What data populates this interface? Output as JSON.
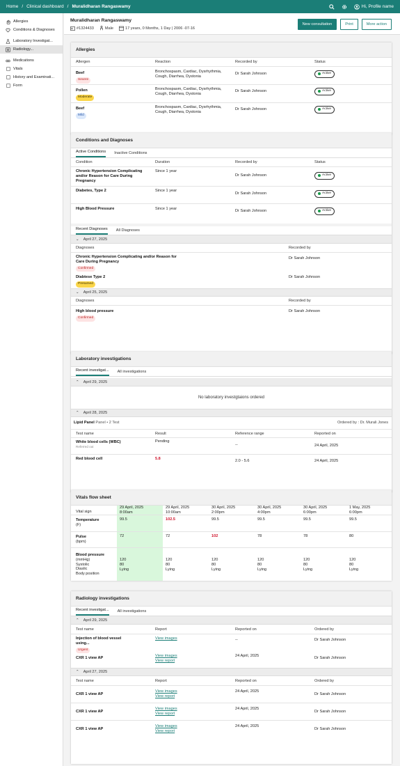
{
  "topbar": {
    "home": "Home",
    "sep": "/",
    "clinical": "Clinical dashboard",
    "patient": "Muralidharan Rangaswamy",
    "profile": "Hi, Profile name"
  },
  "sidebar": {
    "items": [
      {
        "label": "Allergies",
        "icon": "allergy-icon"
      },
      {
        "label": "Conditions & Diagnoses",
        "icon": "heart-icon"
      },
      {
        "label": "Laboratory Investigat...",
        "icon": "flask-icon"
      },
      {
        "label": "Radiology...",
        "icon": "xray-icon"
      },
      {
        "label": "Medications",
        "icon": "pill-icon"
      },
      {
        "label": "Vitals",
        "icon": "checkbox-icon"
      },
      {
        "label": "History and Examinati...",
        "icon": "checkbox-icon"
      },
      {
        "label": "Form",
        "icon": "checkbox-icon"
      }
    ]
  },
  "patient": {
    "name": "Muralidharan Rangaswamy",
    "id": "#1324433",
    "gender": "Male",
    "age": "17 years, 0 Months, 1 Day | 2006 -07-16"
  },
  "actions": {
    "new": "New consultation",
    "print": "Print",
    "more": "More action"
  },
  "allergies": {
    "title": "Allergies",
    "headers": [
      "Allergen",
      "Reaction",
      "Recorded by",
      "Status"
    ],
    "rows": [
      {
        "allergen": "Beef",
        "severity": "Severe",
        "reaction": "Bronchospasm, Cardiac, Dysrhythmia, Cough, Diarrhea, Dystonia",
        "by": "Dr Sarah Johnson",
        "status": "Active"
      },
      {
        "allergen": "Pollen",
        "severity": "Moderate",
        "reaction": "Bronchospasm, Cardiac, Dysrhythmia, Cough, Diarrhea, Dystonia",
        "by": "Dr Sarah Johnson",
        "status": "Active"
      },
      {
        "allergen": "Beef",
        "severity": "Mild",
        "reaction": "Bronchospasm, Cardiac, Dysrhythmia, Cough, Diarrhea, Dystonia",
        "by": "Dr Sarah Johnson",
        "status": "Active"
      }
    ]
  },
  "conditions": {
    "title": "Conditions and Diagnoses",
    "tab1": "Active Conditions",
    "tab2": "Inactive Conditions",
    "headers": [
      "Condition",
      "Duration",
      "Recorded by",
      "Status"
    ],
    "rows": [
      {
        "name": "Chronic Hypertension Complicating and/or Reason for Care During Pregnancy",
        "duration": "Since 1 year",
        "by": "Dr Sarah Johnson",
        "status": "Active"
      },
      {
        "name": "Diabetes, Type 2",
        "duration": "Since 1 year",
        "by": "Dr Sarah Johnson",
        "status": "Active"
      },
      {
        "name": "High Blood Pressure",
        "duration": "Since 1 year",
        "by": "Dr Sarah Johnson",
        "status": "Active"
      }
    ],
    "dtab1": "Recent Diagnoses",
    "dtab2": "All Diagnoses",
    "dheaders": [
      "Diagnoses",
      "Recorded by"
    ],
    "groups": [
      {
        "date": "April 27, 2025",
        "items": [
          {
            "name": "Chronic Hypertension Complicating and/or Reason for Care During Pregnancy",
            "badge": "Confirmed",
            "by": "Dr Sarah Johnson"
          },
          {
            "name": "Diabtese Type 2",
            "badge": "Presumed",
            "by": "Dr Sarah Johnson"
          }
        ]
      },
      {
        "date": "April 25, 2025",
        "items": [
          {
            "name": "High blood pressure",
            "badge": "Confirmed",
            "by": "Dr Sarah Johnson"
          }
        ]
      }
    ]
  },
  "lab": {
    "title": "Laboratory investigations",
    "tab1": "Recent investigat...",
    "tab2": "All investigations",
    "g1": "April 29, 2025",
    "empty": "No laboratory investgtaions ordered",
    "g2": "April 28, 2025",
    "panel": "Lipid Panel",
    "panel_meta": "Panel • 2 Test",
    "ordered": "Ordered by : Dr. Murali Jones",
    "headers": [
      "Test name",
      "Result",
      "Reference range",
      "Reported on"
    ],
    "rows": [
      {
        "name": "White blood cells (WBC)",
        "sub": "Referred out",
        "result": "Pending",
        "range": "--",
        "reported": "24 April, 2025"
      },
      {
        "name": "Red blood cell",
        "result": "5.8",
        "range": "2.0 - 5.6",
        "reported": "24 April, 2025"
      }
    ]
  },
  "vitals": {
    "title": "Vitals flow sheet",
    "label": "Vital sign",
    "cols": [
      {
        "d": "29 April, 2025",
        "t": "8:00am"
      },
      {
        "d": "29 April, 2025",
        "t": "10:00am"
      },
      {
        "d": "30 April, 2025",
        "t": "2:00pm"
      },
      {
        "d": "30 April, 2025",
        "t": "4:00pm"
      },
      {
        "d": "30 April, 2025",
        "t": "6:00pm"
      },
      {
        "d": "1 May, 2025",
        "t": "6:00pm"
      }
    ],
    "temp": {
      "name": "Temperature",
      "unit": "(F)",
      "values": [
        "99.5",
        "102.5",
        "99.5",
        "99.5",
        "99.5",
        "99.5"
      ]
    },
    "pulse": {
      "name": "Pulse",
      "unit": "(bpm)",
      "values": [
        "72",
        "72",
        "102",
        "78",
        "78",
        "80"
      ]
    },
    "bp": {
      "name": "Blood pressure",
      "unit": "(mmHg)",
      "l1": "Systolic",
      "l2": "Diaslic",
      "l3": "Body position",
      "sys": [
        "120",
        "120",
        "120",
        "120",
        "120",
        "120"
      ],
      "dia": [
        "80",
        "80",
        "80",
        "80",
        "80",
        "80"
      ],
      "pos": [
        "Lying",
        "Lying",
        "Lying",
        "Lying",
        "Lying",
        "Lying"
      ]
    },
    "highlight": "#d9f7dc",
    "alert": "#d0142c"
  },
  "radiology": {
    "title": "Radiology investigations",
    "tab1": "Recent investigat...",
    "tab2": "All investigations",
    "headers": [
      "Test name",
      "Report",
      "Reported on",
      "Ordered by"
    ],
    "g1": "April 29, 2025",
    "r1": [
      {
        "name": "Injection of blood vessel using...",
        "badge": "Urgent",
        "link1": "View images",
        "link2": "",
        "reported": "--",
        "by": "Dr Sarah Johnson"
      },
      {
        "name": "CXR 1 view AP",
        "badge": "",
        "link1": "View images",
        "link2": "View report",
        "reported": "24 April, 2025",
        "by": "Dr Sarah Johnson"
      }
    ],
    "g2": "April 27, 2025",
    "r2": [
      {
        "name": "CXR 1 view AP",
        "link1": "View images",
        "link2": "View report",
        "reported": "24 April, 2025",
        "by": "Dr Sarah Johnson"
      },
      {
        "name": "CXR 1 view AP",
        "link1": "View images",
        "link2": "View report",
        "reported": "24 April, 2025",
        "by": "Dr Sarah Johnson"
      },
      {
        "name": "CXR 1 view AP",
        "link1": "View images",
        "link2": "View report",
        "reported": "24 April, 2025",
        "by": "Dr Sarah Johnson"
      }
    ]
  },
  "colors": {
    "brand": "#1b7e77"
  }
}
